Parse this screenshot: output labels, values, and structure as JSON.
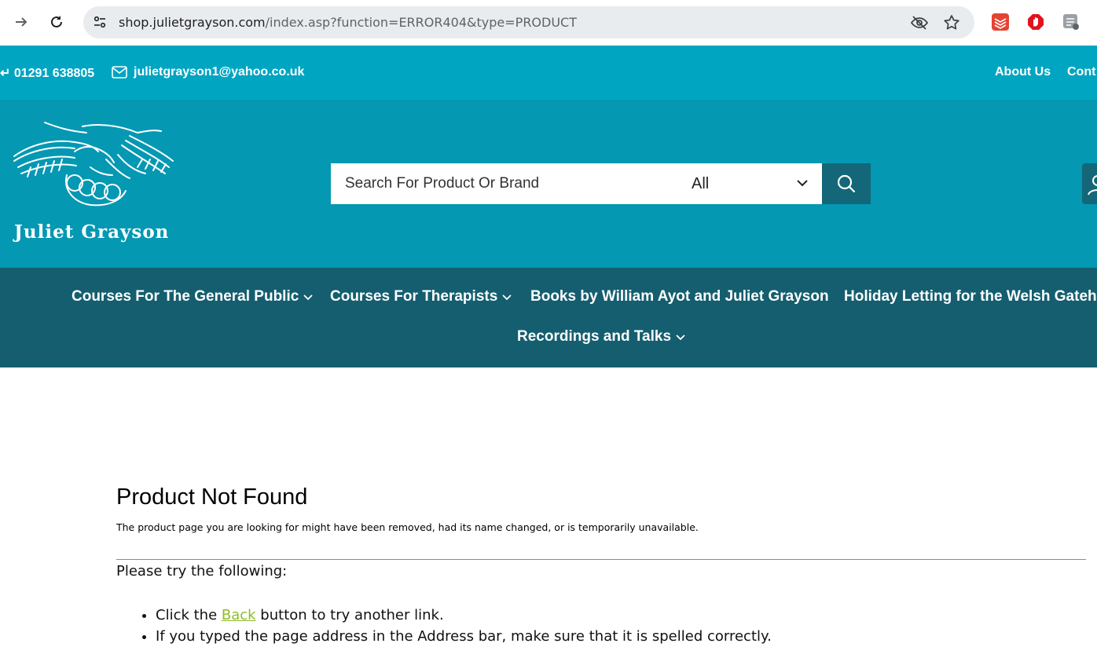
{
  "browser": {
    "url_host": "shop.julietgrayson.com",
    "url_path": "/index.asp?function=ERROR404&type=PRODUCT"
  },
  "topbar": {
    "phone": "01291 638805",
    "email": "julietgrayson1@yahoo.co.uk",
    "links": [
      "About Us",
      "Cont"
    ]
  },
  "header": {
    "logo_text": "Juliet Grayson",
    "search_placeholder": "Search For Product Or Brand",
    "category_selected": "All"
  },
  "nav": {
    "items": [
      {
        "label": "Courses For The General Public",
        "has_dropdown": true
      },
      {
        "label": "Courses For Therapists",
        "has_dropdown": true
      },
      {
        "label": "Books by William Ayot and Juliet Grayson",
        "has_dropdown": false
      },
      {
        "label": "Holiday Letting for the Welsh Gateho",
        "has_dropdown": false
      },
      {
        "label": "Recordings and Talks",
        "has_dropdown": true
      }
    ]
  },
  "content": {
    "title": "Product Not Found",
    "description": "The product page you are looking for might have been removed, had its name changed, or is temporarily unavailable.",
    "try_heading": "Please try the following:",
    "tip1_prefix": "Click the ",
    "tip1_link": "Back",
    "tip1_suffix": " button to try another link.",
    "tip2": "If you typed the page address in the Address bar, make sure that it is spelled correctly."
  },
  "colors": {
    "topbar": "#00a5c2",
    "header": "#0498b3",
    "nav": "#145e6f",
    "search_button": "#136778",
    "link": "#8bbd24"
  }
}
